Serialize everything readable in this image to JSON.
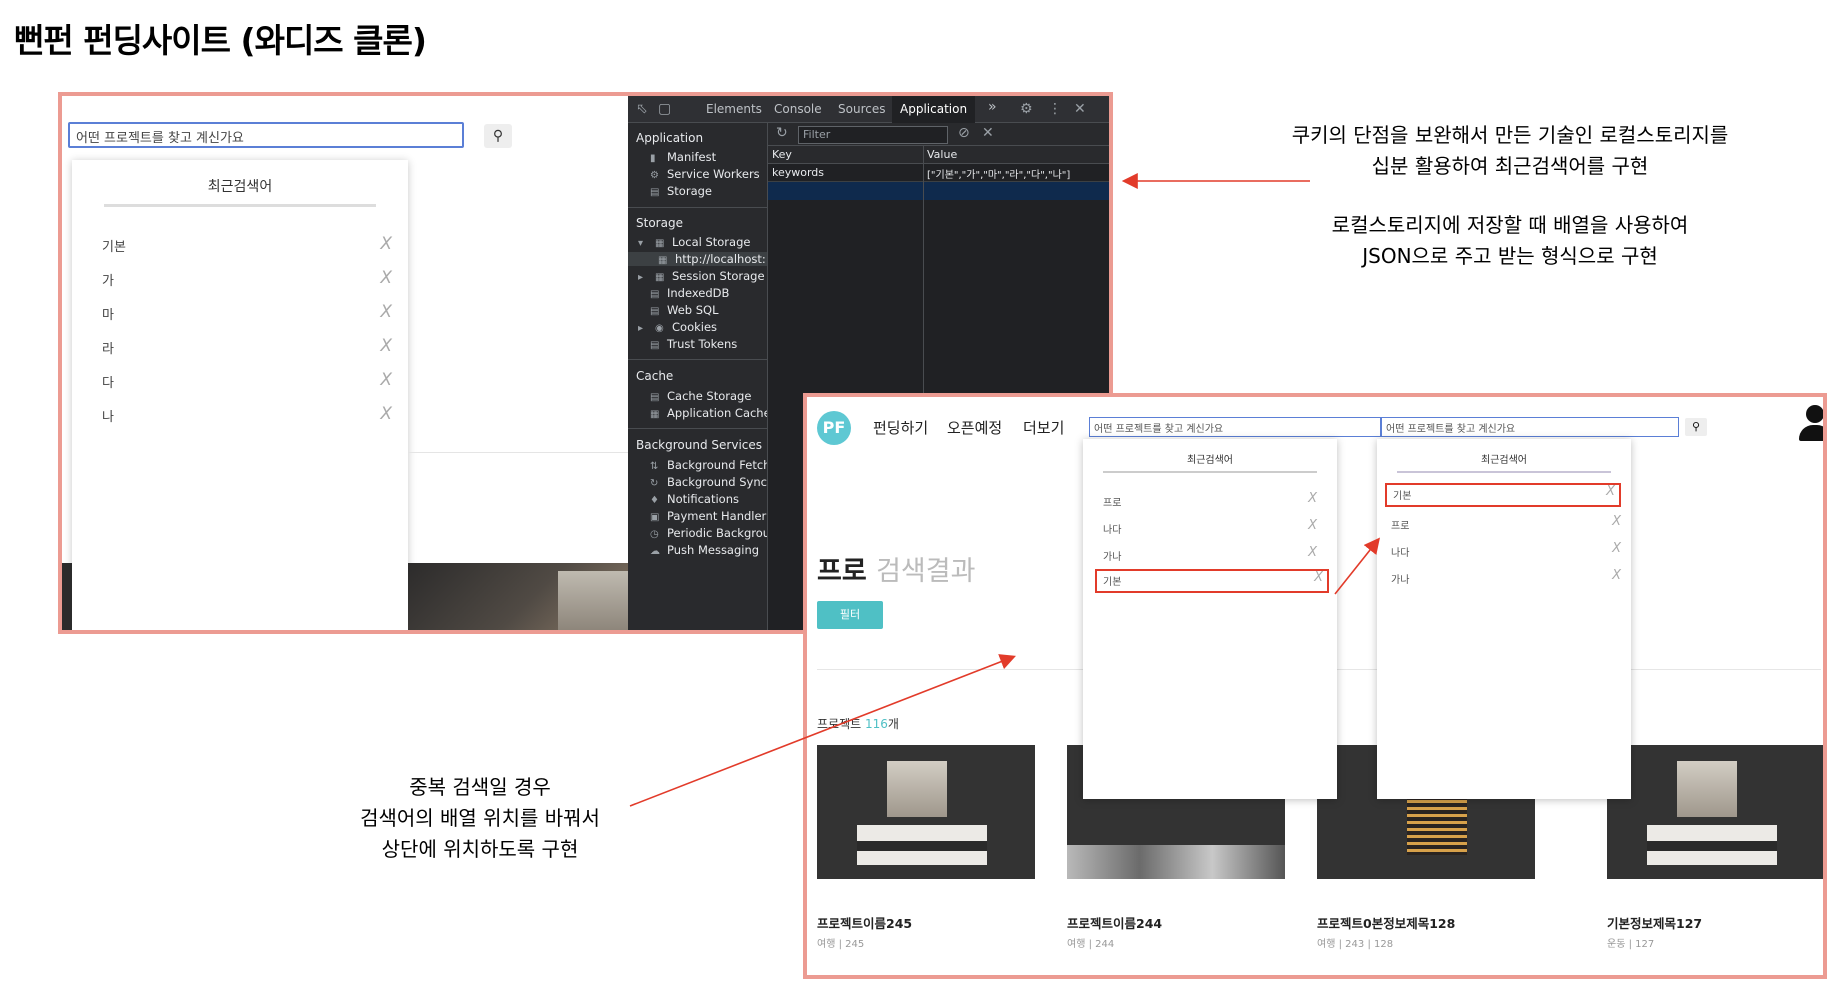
{
  "page_title": "뻔펀 펀딩사이트 (와디즈 클론)",
  "shot1": {
    "search_value": "어떤 프로젝트를 찾고 계신가요",
    "search_icon": "magnifier-icon",
    "dropdown": {
      "title": "최근검색어",
      "items": [
        "기본",
        "가",
        "마",
        "라",
        "다",
        "나"
      ],
      "delete_glyph": "X"
    }
  },
  "devtools": {
    "tabs": [
      "Elements",
      "Console",
      "Sources",
      "Application"
    ],
    "active_tab": "Application",
    "more_glyph": "»",
    "sidebar": {
      "application_header": "Application",
      "application_items": [
        "Manifest",
        "Service Workers",
        "Storage"
      ],
      "storage_header": "Storage",
      "storage_items": [
        "Local Storage",
        "http://localhost:",
        "Session Storage",
        "IndexedDB",
        "Web SQL",
        "Cookies",
        "Trust Tokens"
      ],
      "cache_header": "Cache",
      "cache_items": [
        "Cache Storage",
        "Application Cache"
      ],
      "bg_header": "Background Services",
      "bg_items": [
        "Background Fetch",
        "Background Sync",
        "Notifications",
        "Payment Handler",
        "Periodic Backgrou",
        "Push Messaging"
      ]
    },
    "filter_placeholder": "Filter",
    "columns": [
      "Key",
      "Value"
    ],
    "rows": [
      {
        "key": "keywords",
        "value": "[\"기본\",\"가\",\"마\",\"라\",\"다\",\"나\"]"
      }
    ]
  },
  "notes": {
    "right_top_line1": "쿠키의 단점을 보완해서 만든 기술인 로컬스토리지를",
    "right_top_line2": "십분 활용하여 최근검색어를 구현",
    "right_mid_line1": "로컬스토리지에 저장할 때 배열을 사용하여",
    "right_mid_line2": "JSON으로 주고 받는 형식으로 구현",
    "bottom_left_line1": "중복 검색일 경우",
    "bottom_left_line2": "검색어의 배열 위치를 바꿔서",
    "bottom_left_line3": "상단에 위치하도록 구현"
  },
  "shot2": {
    "logo": "PF",
    "nav": [
      "펀딩하기",
      "오픈예정",
      "더보기"
    ],
    "search_value_1": "어떤 프로젝트를 찾고 계신가요",
    "search_value_2": "어떤 프로젝트를 찾고 계신가요",
    "result_keyword": "프로",
    "result_suffix": "검색결과",
    "filter_button": "필터",
    "project_label": "프로젝트",
    "project_count": "116",
    "project_unit": "개",
    "dropdown_before": {
      "title": "최근검색어",
      "items": [
        "프로",
        "나다",
        "가나",
        "기본"
      ],
      "delete_glyph": "X"
    },
    "dropdown_after": {
      "title": "최근검색어",
      "items": [
        "기본",
        "프로",
        "나다",
        "가나"
      ],
      "delete_glyph": "X"
    },
    "cards": [
      {
        "title": "프로젝트이름245",
        "category": "여행",
        "sep": "|",
        "num": "245"
      },
      {
        "title": "프로젝트이름244",
        "category": "여행",
        "sep": "|",
        "num": "244"
      },
      {
        "title": "프로젝트0본정보제목128",
        "category": "여행",
        "sep": "|",
        "num": "243",
        "sep2": "|",
        "num2": "128"
      },
      {
        "title": "기본정보제목127",
        "category": "운동",
        "sep": "|",
        "num": "127"
      }
    ]
  },
  "colors": {
    "frame_border": "#ec9b92",
    "accent_teal": "#4fc0c5",
    "highlight_red": "#e23b2a",
    "devtools_bg": "#292a2d"
  }
}
